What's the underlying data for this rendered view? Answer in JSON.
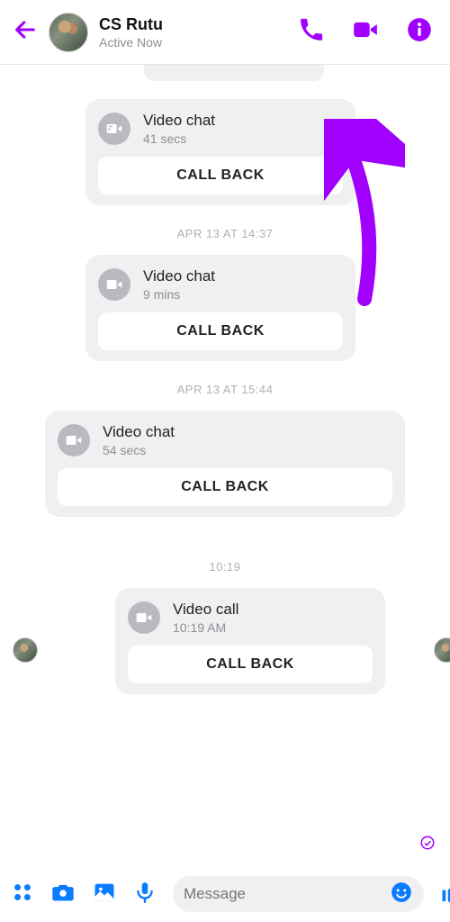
{
  "header": {
    "name": "CS Rutu",
    "status": "Active Now"
  },
  "messages": [
    {
      "title": "Video chat",
      "duration": "41 secs",
      "callback": "CALL BACK",
      "variant": "out"
    },
    {
      "title": "Video chat",
      "duration": "9 mins",
      "callback": "CALL BACK",
      "variant": "out"
    },
    {
      "title": "Video chat",
      "duration": "54 secs",
      "callback": "CALL BACK",
      "variant": "in"
    },
    {
      "title": "Video call",
      "duration": "10:19 AM",
      "callback": "CALL BACK",
      "variant": "missed"
    }
  ],
  "timestamps": {
    "t1": "APR 13 AT 14:37",
    "t2": "APR 13 AT 15:44",
    "t3": "10:19"
  },
  "composer": {
    "placeholder": "Message"
  },
  "colors": {
    "accent": "#a100ff",
    "footer": "#0a7cff"
  }
}
